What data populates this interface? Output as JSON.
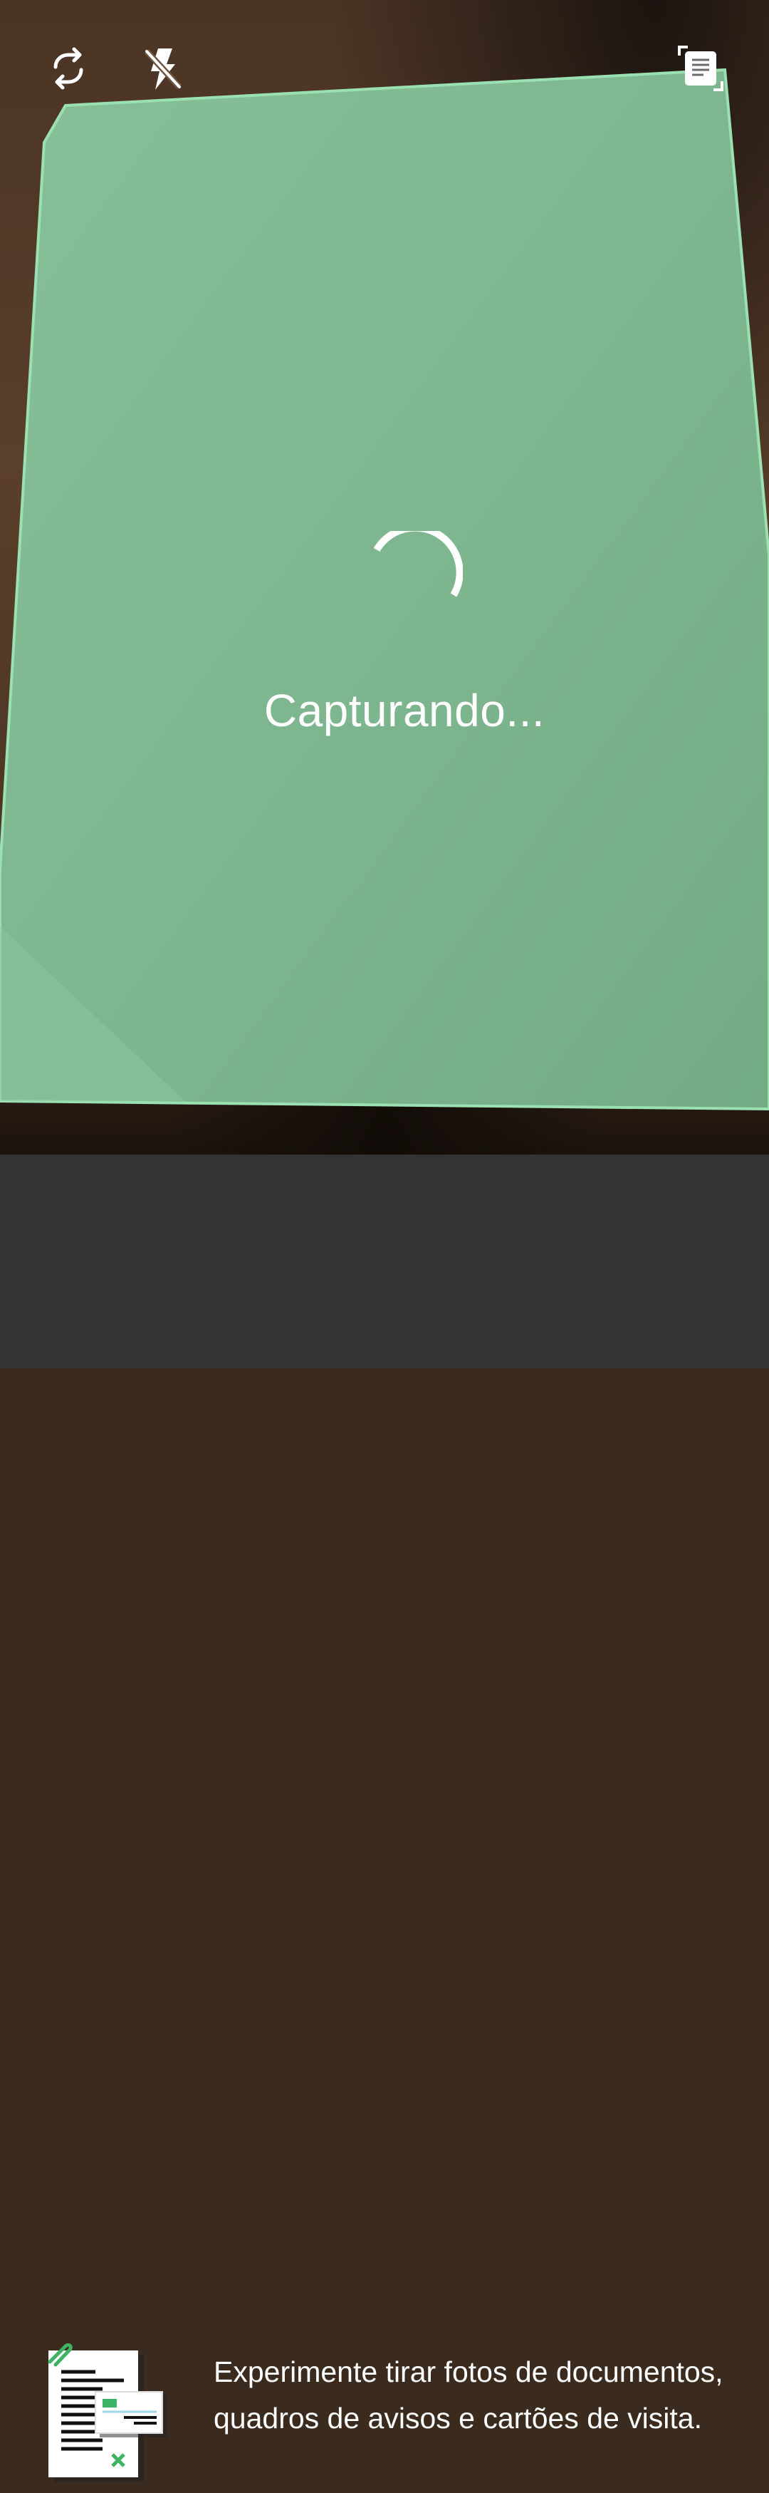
{
  "toolbar": {
    "switch_camera_icon": "switch-camera-icon",
    "flash_icon": "flash-off-icon",
    "doc_mode_icon": "document-scan-icon"
  },
  "capture": {
    "status": "Capturando...",
    "overlay_color": "#7fbd92",
    "outline_color": "#8fd9a6"
  },
  "tip": {
    "text": "Experimente tirar fotos de documentos, quadros de avisos e cartões de visita.",
    "illustration_icon": "documents-illustration-icon"
  }
}
